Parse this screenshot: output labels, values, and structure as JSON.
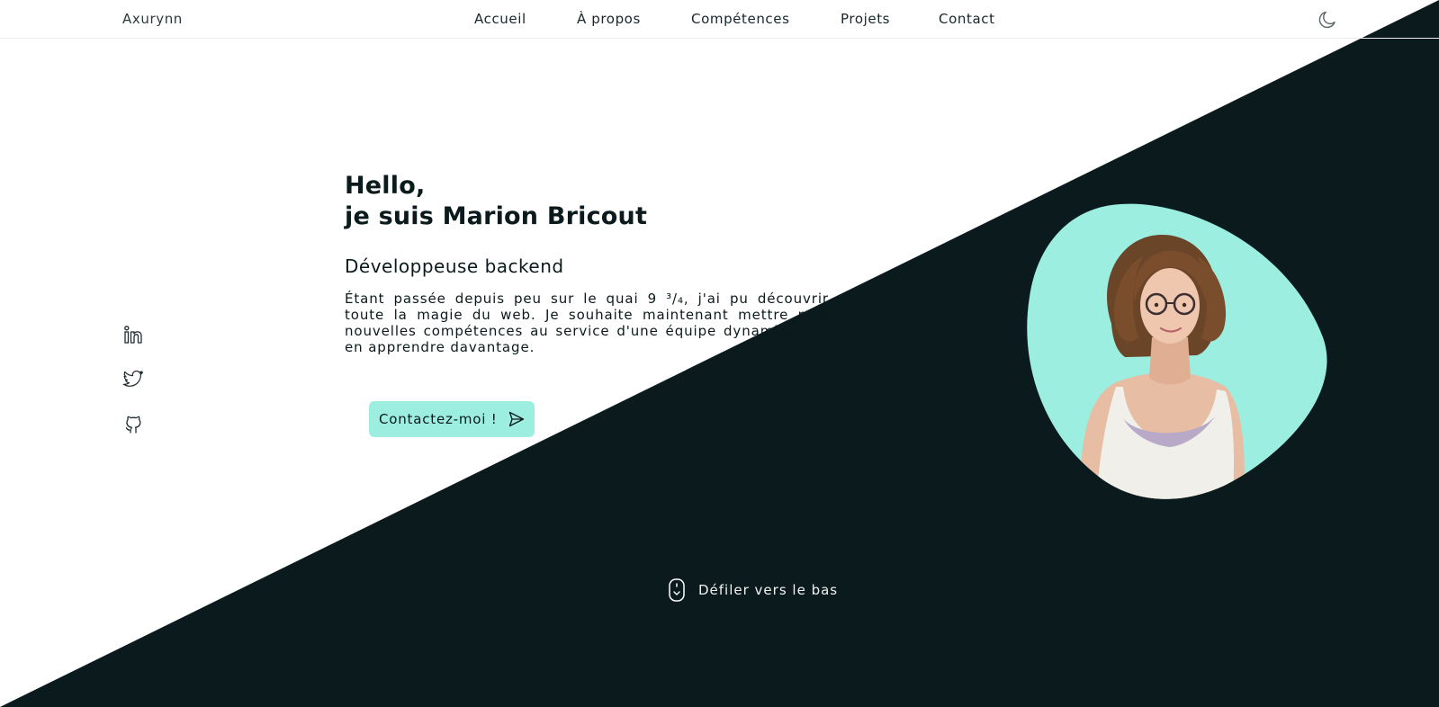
{
  "header": {
    "logo": "Axurynn",
    "nav": [
      "Accueil",
      "À propos",
      "Compétences",
      "Projets",
      "Contact"
    ],
    "theme_toggle_icon": "moon-icon"
  },
  "hero": {
    "greeting_line1": "Hello,",
    "greeting_line2": "je suis Marion Bricout",
    "subtitle": "Développeuse backend",
    "description": "Étant passée depuis peu sur le quai 9 ³/₄, j'ai pu découvrir toute la magie du web. Je souhaite maintenant mettre mes nouvelles compétences au service d'une équipe dynamique et en apprendre davantage.",
    "cta_label": "Contactez-moi !",
    "cta_icon": "send-icon"
  },
  "social": [
    "linkedin-icon",
    "twitter-icon",
    "github-icon"
  ],
  "scroll": {
    "label": "Défiler vers le bas",
    "icon": "mouse-icon"
  },
  "colors": {
    "dark": "#0b1a1c",
    "accent": "#9ceee0",
    "background": "#ffffff"
  }
}
